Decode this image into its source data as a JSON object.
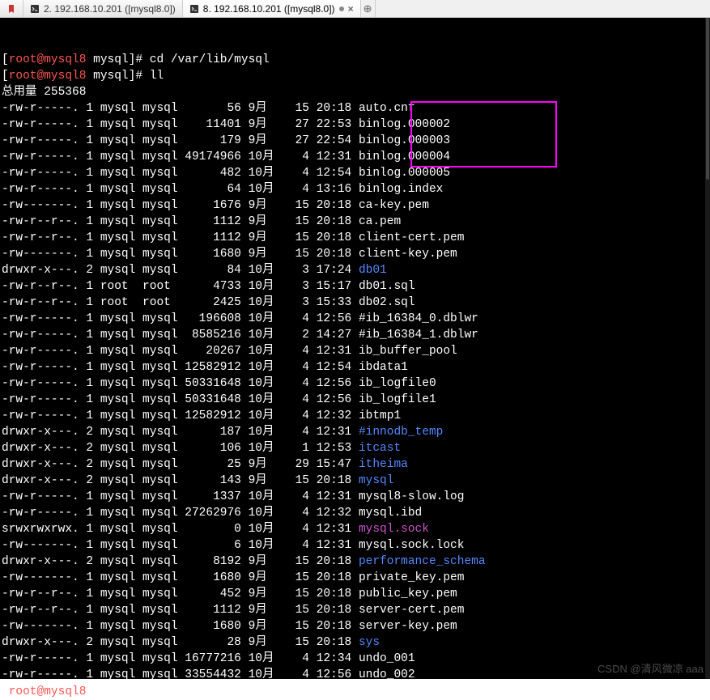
{
  "tabs": [
    {
      "pin": true,
      "label": ""
    },
    {
      "label": "2. 192.168.10.201 ([mysql8.0])",
      "active": false
    },
    {
      "label": "8. 192.168.10.201 ([mysql8.0])",
      "active": true
    }
  ],
  "prompt": {
    "user": "root",
    "host": "mysql8",
    "cwd": "mysql",
    "sep": "@",
    "end": "]#"
  },
  "commands": [
    "cd /var/lib/mysql",
    "ll"
  ],
  "total_label": "总用量 255368",
  "files": [
    {
      "perm": "-rw-r-----.",
      "n": "1",
      "o": "mysql",
      "g": "mysql",
      "size": "56",
      "mon": "9月",
      "day": "15",
      "time": "20:18",
      "name": "auto.cnf",
      "cls": "",
      "hl": false
    },
    {
      "perm": "-rw-r-----.",
      "n": "1",
      "o": "mysql",
      "g": "mysql",
      "size": "11401",
      "mon": "9月",
      "day": "27",
      "time": "22:53",
      "name": "binlog.000002",
      "cls": "",
      "hl": true
    },
    {
      "perm": "-rw-r-----.",
      "n": "1",
      "o": "mysql",
      "g": "mysql",
      "size": "179",
      "mon": "9月",
      "day": "27",
      "time": "22:54",
      "name": "binlog.000003",
      "cls": "",
      "hl": true
    },
    {
      "perm": "-rw-r-----.",
      "n": "1",
      "o": "mysql",
      "g": "mysql",
      "size": "49174966",
      "mon": "10月",
      "day": "4",
      "time": "12:31",
      "name": "binlog.000004",
      "cls": "",
      "hl": true
    },
    {
      "perm": "-rw-r-----.",
      "n": "1",
      "o": "mysql",
      "g": "mysql",
      "size": "482",
      "mon": "10月",
      "day": "4",
      "time": "12:54",
      "name": "binlog.000005",
      "cls": "",
      "hl": true
    },
    {
      "perm": "-rw-r-----.",
      "n": "1",
      "o": "mysql",
      "g": "mysql",
      "size": "64",
      "mon": "10月",
      "day": "4",
      "time": "13:16",
      "name": "binlog.index",
      "cls": "",
      "hl": false
    },
    {
      "perm": "-rw-------.",
      "n": "1",
      "o": "mysql",
      "g": "mysql",
      "size": "1676",
      "mon": "9月",
      "day": "15",
      "time": "20:18",
      "name": "ca-key.pem",
      "cls": "",
      "hl": false
    },
    {
      "perm": "-rw-r--r--.",
      "n": "1",
      "o": "mysql",
      "g": "mysql",
      "size": "1112",
      "mon": "9月",
      "day": "15",
      "time": "20:18",
      "name": "ca.pem",
      "cls": "",
      "hl": false
    },
    {
      "perm": "-rw-r--r--.",
      "n": "1",
      "o": "mysql",
      "g": "mysql",
      "size": "1112",
      "mon": "9月",
      "day": "15",
      "time": "20:18",
      "name": "client-cert.pem",
      "cls": "",
      "hl": false
    },
    {
      "perm": "-rw-------.",
      "n": "1",
      "o": "mysql",
      "g": "mysql",
      "size": "1680",
      "mon": "9月",
      "day": "15",
      "time": "20:18",
      "name": "client-key.pem",
      "cls": "",
      "hl": false
    },
    {
      "perm": "drwxr-x---.",
      "n": "2",
      "o": "mysql",
      "g": "mysql",
      "size": "84",
      "mon": "10月",
      "day": "3",
      "time": "17:24",
      "name": "db01",
      "cls": "dir",
      "hl": false
    },
    {
      "perm": "-rw-r--r--.",
      "n": "1",
      "o": "root ",
      "g": "root ",
      "size": "4733",
      "mon": "10月",
      "day": "3",
      "time": "15:17",
      "name": "db01.sql",
      "cls": "",
      "hl": false
    },
    {
      "perm": "-rw-r--r--.",
      "n": "1",
      "o": "root ",
      "g": "root ",
      "size": "2425",
      "mon": "10月",
      "day": "3",
      "time": "15:33",
      "name": "db02.sql",
      "cls": "",
      "hl": false
    },
    {
      "perm": "-rw-r-----.",
      "n": "1",
      "o": "mysql",
      "g": "mysql",
      "size": "196608",
      "mon": "10月",
      "day": "4",
      "time": "12:56",
      "name": "#ib_16384_0.dblwr",
      "cls": "",
      "hl": false
    },
    {
      "perm": "-rw-r-----.",
      "n": "1",
      "o": "mysql",
      "g": "mysql",
      "size": "8585216",
      "mon": "10月",
      "day": "2",
      "time": "14:27",
      "name": "#ib_16384_1.dblwr",
      "cls": "",
      "hl": false
    },
    {
      "perm": "-rw-r-----.",
      "n": "1",
      "o": "mysql",
      "g": "mysql",
      "size": "20267",
      "mon": "10月",
      "day": "4",
      "time": "12:31",
      "name": "ib_buffer_pool",
      "cls": "",
      "hl": false
    },
    {
      "perm": "-rw-r-----.",
      "n": "1",
      "o": "mysql",
      "g": "mysql",
      "size": "12582912",
      "mon": "10月",
      "day": "4",
      "time": "12:54",
      "name": "ibdata1",
      "cls": "",
      "hl": false
    },
    {
      "perm": "-rw-r-----.",
      "n": "1",
      "o": "mysql",
      "g": "mysql",
      "size": "50331648",
      "mon": "10月",
      "day": "4",
      "time": "12:56",
      "name": "ib_logfile0",
      "cls": "",
      "hl": false
    },
    {
      "perm": "-rw-r-----.",
      "n": "1",
      "o": "mysql",
      "g": "mysql",
      "size": "50331648",
      "mon": "10月",
      "day": "4",
      "time": "12:56",
      "name": "ib_logfile1",
      "cls": "",
      "hl": false
    },
    {
      "perm": "-rw-r-----.",
      "n": "1",
      "o": "mysql",
      "g": "mysql",
      "size": "12582912",
      "mon": "10月",
      "day": "4",
      "time": "12:32",
      "name": "ibtmp1",
      "cls": "",
      "hl": false
    },
    {
      "perm": "drwxr-x---.",
      "n": "2",
      "o": "mysql",
      "g": "mysql",
      "size": "187",
      "mon": "10月",
      "day": "4",
      "time": "12:31",
      "name": "#innodb_temp",
      "cls": "dir",
      "hl": false
    },
    {
      "perm": "drwxr-x---.",
      "n": "2",
      "o": "mysql",
      "g": "mysql",
      "size": "106",
      "mon": "10月",
      "day": "1",
      "time": "12:53",
      "name": "itcast",
      "cls": "dir",
      "hl": false
    },
    {
      "perm": "drwxr-x---.",
      "n": "2",
      "o": "mysql",
      "g": "mysql",
      "size": "25",
      "mon": "9月",
      "day": "29",
      "time": "15:47",
      "name": "itheima",
      "cls": "dir",
      "hl": false
    },
    {
      "perm": "drwxr-x---.",
      "n": "2",
      "o": "mysql",
      "g": "mysql",
      "size": "143",
      "mon": "9月",
      "day": "15",
      "time": "20:18",
      "name": "mysql",
      "cls": "dir",
      "hl": false
    },
    {
      "perm": "-rw-r-----.",
      "n": "1",
      "o": "mysql",
      "g": "mysql",
      "size": "1337",
      "mon": "10月",
      "day": "4",
      "time": "12:31",
      "name": "mysql8-slow.log",
      "cls": "",
      "hl": false
    },
    {
      "perm": "-rw-r-----.",
      "n": "1",
      "o": "mysql",
      "g": "mysql",
      "size": "27262976",
      "mon": "10月",
      "day": "4",
      "time": "12:32",
      "name": "mysql.ibd",
      "cls": "",
      "hl": false
    },
    {
      "perm": "srwxrwxrwx.",
      "n": "1",
      "o": "mysql",
      "g": "mysql",
      "size": "0",
      "mon": "10月",
      "day": "4",
      "time": "12:31",
      "name": "mysql.sock",
      "cls": "sock",
      "hl": false
    },
    {
      "perm": "-rw-------.",
      "n": "1",
      "o": "mysql",
      "g": "mysql",
      "size": "6",
      "mon": "10月",
      "day": "4",
      "time": "12:31",
      "name": "mysql.sock.lock",
      "cls": "",
      "hl": false
    },
    {
      "perm": "drwxr-x---.",
      "n": "2",
      "o": "mysql",
      "g": "mysql",
      "size": "8192",
      "mon": "9月",
      "day": "15",
      "time": "20:18",
      "name": "performance_schema",
      "cls": "dir",
      "hl": false
    },
    {
      "perm": "-rw-------.",
      "n": "1",
      "o": "mysql",
      "g": "mysql",
      "size": "1680",
      "mon": "9月",
      "day": "15",
      "time": "20:18",
      "name": "private_key.pem",
      "cls": "",
      "hl": false
    },
    {
      "perm": "-rw-r--r--.",
      "n": "1",
      "o": "mysql",
      "g": "mysql",
      "size": "452",
      "mon": "9月",
      "day": "15",
      "time": "20:18",
      "name": "public_key.pem",
      "cls": "",
      "hl": false
    },
    {
      "perm": "-rw-r--r--.",
      "n": "1",
      "o": "mysql",
      "g": "mysql",
      "size": "1112",
      "mon": "9月",
      "day": "15",
      "time": "20:18",
      "name": "server-cert.pem",
      "cls": "",
      "hl": false
    },
    {
      "perm": "-rw-------.",
      "n": "1",
      "o": "mysql",
      "g": "mysql",
      "size": "1680",
      "mon": "9月",
      "day": "15",
      "time": "20:18",
      "name": "server-key.pem",
      "cls": "",
      "hl": false
    },
    {
      "perm": "drwxr-x---.",
      "n": "2",
      "o": "mysql",
      "g": "mysql",
      "size": "28",
      "mon": "9月",
      "day": "15",
      "time": "20:18",
      "name": "sys",
      "cls": "dir",
      "hl": false
    },
    {
      "perm": "-rw-r-----.",
      "n": "1",
      "o": "mysql",
      "g": "mysql",
      "size": "16777216",
      "mon": "10月",
      "day": "4",
      "time": "12:34",
      "name": "undo_001",
      "cls": "",
      "hl": false
    },
    {
      "perm": "-rw-r-----.",
      "n": "1",
      "o": "mysql",
      "g": "mysql",
      "size": "33554432",
      "mon": "10月",
      "day": "4",
      "time": "12:56",
      "name": "undo_002",
      "cls": "",
      "hl": false
    }
  ],
  "watermark": "CSDN @清风微凉 aaa"
}
